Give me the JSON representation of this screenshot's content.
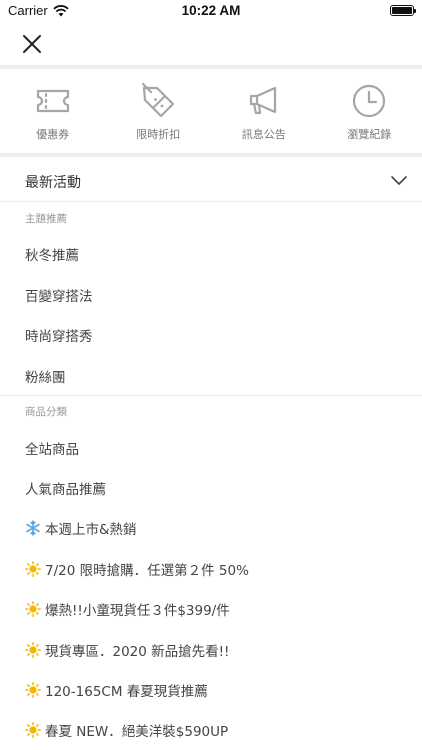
{
  "status_bar": {
    "carrier": "Carrier",
    "time": "10:22 AM"
  },
  "quick_actions": [
    {
      "label": "優惠券",
      "icon": "ticket-icon"
    },
    {
      "label": "限時折扣",
      "icon": "discount-tag-icon"
    },
    {
      "label": "訊息公告",
      "icon": "megaphone-icon"
    },
    {
      "label": "瀏覽紀錄",
      "icon": "clock-icon"
    }
  ],
  "activity": {
    "title": "最新活動"
  },
  "theme_section": {
    "label": "主題推薦",
    "items": [
      "秋冬推薦",
      "百變穿搭法",
      "時尚穿搭秀",
      "粉絲團"
    ]
  },
  "category_section": {
    "label": "商品分類",
    "items": [
      {
        "text": "全站商品"
      },
      {
        "text": "人氣商品推薦"
      },
      {
        "text": "本週上市&熱銷",
        "icon": "snowflake-icon"
      },
      {
        "text": "7/20 限時搶購．任選第２件 50%",
        "icon": "sun-icon"
      },
      {
        "text": "爆熱!!小童現貨任３件$399/件",
        "icon": "sun-icon"
      },
      {
        "text": "現貨專區．2020 新品搶先看!!",
        "icon": "sun-icon"
      },
      {
        "text": "120-165CM 春夏現貨推薦",
        "icon": "sun-icon"
      },
      {
        "text": "春夏 NEW．絕美洋裝$590UP",
        "icon": "sun-icon"
      }
    ]
  },
  "colors": {
    "icon_gray": "#a6a6a6",
    "divider": "#eeeeee",
    "sun": "#f7b500",
    "snowflake": "#5aa9e6"
  }
}
